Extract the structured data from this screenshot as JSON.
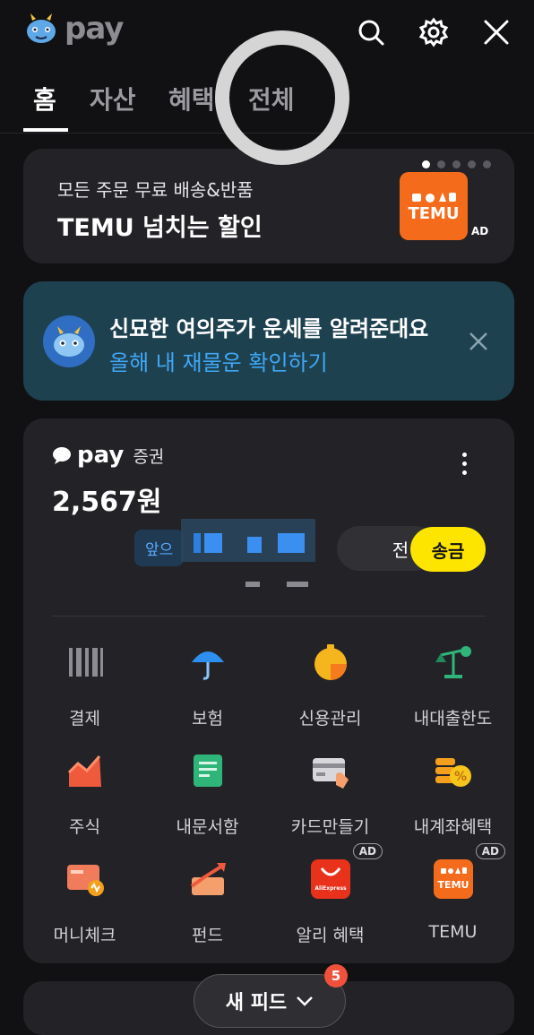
{
  "header": {
    "logo_text": "pay",
    "icons": [
      "search-icon",
      "gear-icon",
      "close-icon"
    ]
  },
  "tabs": [
    {
      "label": "홈",
      "active": true
    },
    {
      "label": "자산",
      "active": false
    },
    {
      "label": "혜택",
      "active": false
    },
    {
      "label": "전체",
      "active": false
    }
  ],
  "banner_ad": {
    "subtitle": "모든 주문 무료 배송&반품",
    "title": "TEMU 넘치는 할인",
    "brand_logo_text": "TEMU",
    "ad_label": "AD",
    "carousel_count": 5,
    "carousel_active": 1
  },
  "fortune_banner": {
    "title": "신묘한 여의주가 운세를 알려준대요",
    "link": "올해 내 재물운 확인하기"
  },
  "account": {
    "brand": "pay",
    "product": "증권",
    "balance": "2,567원",
    "left_chip": "앞으",
    "charge_label": "전",
    "send_label": "송금"
  },
  "services": [
    {
      "label": "결제",
      "icon": "barcode-icon"
    },
    {
      "label": "보험",
      "icon": "umbrella-icon"
    },
    {
      "label": "신용관리",
      "icon": "credit-score-icon"
    },
    {
      "label": "내대출한도",
      "icon": "scale-icon"
    },
    {
      "label": "주식",
      "icon": "stock-chart-icon"
    },
    {
      "label": "내문서함",
      "icon": "document-icon"
    },
    {
      "label": "카드만들기",
      "icon": "card-icon"
    },
    {
      "label": "내계좌혜택",
      "icon": "coin-percent-icon"
    },
    {
      "label": "머니체크",
      "icon": "money-check-icon"
    },
    {
      "label": "펀드",
      "icon": "fund-icon"
    },
    {
      "label": "알리 혜택",
      "icon": "aliexpress-icon",
      "ad": "AD",
      "logo_text": "AliExpress"
    },
    {
      "label": "TEMU",
      "icon": "temu-icon",
      "ad": "AD",
      "logo_text": "TEMU"
    }
  ],
  "feed": {
    "label": "새 피드",
    "badge": "5"
  },
  "colors": {
    "background": "#111113",
    "card": "#232327",
    "accent_yellow": "#fee500",
    "link_blue": "#3fa8f5",
    "fortune_bg": "#1e4150",
    "temu_orange": "#f56b1c"
  }
}
